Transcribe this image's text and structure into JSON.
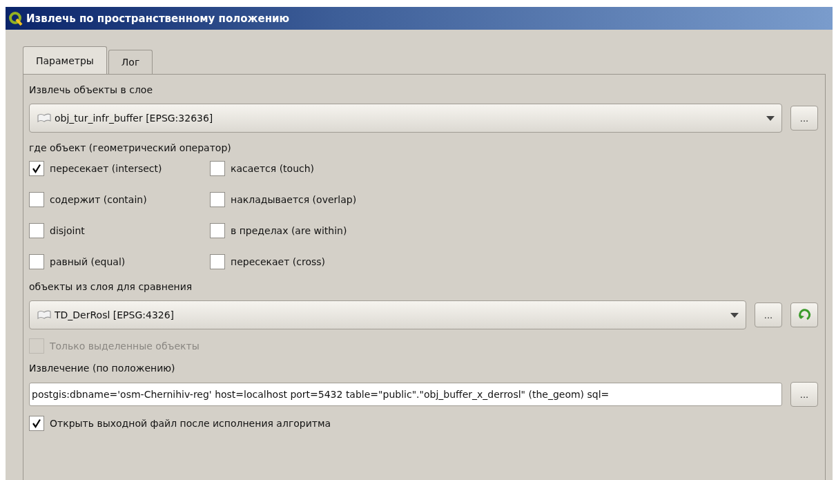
{
  "window": {
    "title": "Извлечь по пространственному положению"
  },
  "tabs": [
    {
      "label": "Параметры",
      "selected": true
    },
    {
      "label": "Лог",
      "selected": false
    }
  ],
  "input_layer": {
    "label": "Извлечь объекты в слое",
    "value": "obj_tur_infr_buffer [EPSG:32636]",
    "button": "..."
  },
  "predicate": {
    "label": "где объект (геометрический оператор)",
    "options": [
      {
        "label": "пересекает (intersect)",
        "checked": true
      },
      {
        "label": "касается (touch)",
        "checked": false
      },
      {
        "label": "содержит (contain)",
        "checked": false
      },
      {
        "label": "накладывается (overlap)",
        "checked": false
      },
      {
        "label": "disjoint",
        "checked": false
      },
      {
        "label": "в пределах (are within)",
        "checked": false
      },
      {
        "label": "равный (equal)",
        "checked": false
      },
      {
        "label": "пересекает (cross)",
        "checked": false
      }
    ]
  },
  "compare_layer": {
    "label": "объекты из слоя для сравнения",
    "value": "TD_DerRosl [EPSG:4326]",
    "button": "..."
  },
  "selected_only": {
    "label": "Только выделенные объекты",
    "checked": false,
    "disabled": true
  },
  "output": {
    "label": "Извлечение (по положению)",
    "value": "postgis:dbname='osm-Chernihiv-reg' host=localhost port=5432 table=\"public\".\"obj_buffer_x_derrosl\" (the_geom) sql=",
    "button": "..."
  },
  "open_output": {
    "label": "Открыть выходной файл после исполнения алгоритма",
    "checked": true,
    "disabled": false
  }
}
